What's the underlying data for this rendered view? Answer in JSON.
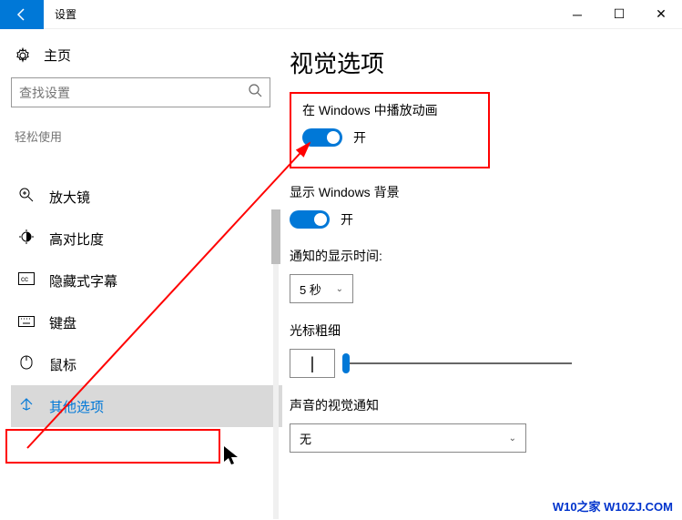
{
  "titlebar": {
    "title": "设置"
  },
  "sidebar": {
    "home": "主页",
    "search_placeholder": "查找设置",
    "group": "轻松使用",
    "items": [
      {
        "icon": "magnifier",
        "label": "放大镜"
      },
      {
        "icon": "contrast",
        "label": "高对比度"
      },
      {
        "icon": "cc",
        "label": "隐藏式字幕"
      },
      {
        "icon": "keyboard",
        "label": "键盘"
      },
      {
        "icon": "mouse",
        "label": "鼠标"
      },
      {
        "icon": "other",
        "label": "其他选项"
      }
    ]
  },
  "main": {
    "title": "视觉选项",
    "animations_label": "在 Windows 中播放动画",
    "animations_state": "开",
    "background_label": "显示 Windows 背景",
    "background_state": "开",
    "notification_label": "通知的显示时间:",
    "notification_value": "5 秒",
    "cursor_label": "光标粗细",
    "sound_label": "声音的视觉通知",
    "sound_value": "无"
  },
  "watermark": "W10之家 W10ZJ.COM"
}
